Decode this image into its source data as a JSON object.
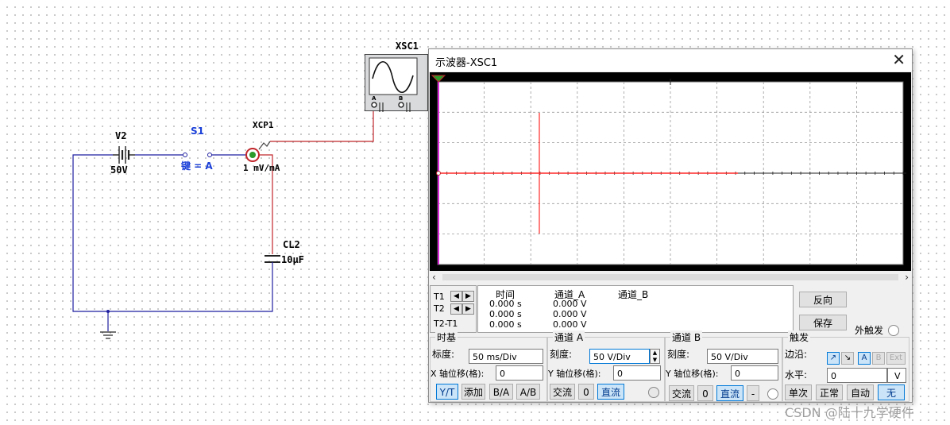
{
  "schematic": {
    "v2_name": "V2",
    "v2_value": "50V",
    "s1_name": "S1",
    "s1_key": "键 = A",
    "xcp1_name": "XCP1",
    "xcp1_ratio": "1  mV/mA",
    "cl2_name": "CL2",
    "cl2_value": "10µF",
    "xsc1_name": "XSC1",
    "xsc1_port_a": "A",
    "xsc1_port_b": "B",
    "wire_color": "#c0262b"
  },
  "dialog": {
    "title": "示波器-XSC1",
    "close": "✕",
    "trace_color": "#ff2828",
    "cursor_color": "#e000e0",
    "cursors": {
      "t1": "T1",
      "t2": "T2",
      "t2t1": "T2-T1"
    },
    "readout": {
      "headers": [
        "时间",
        "通道_A",
        "通道_B"
      ],
      "rows": [
        {
          "time": "0.000 s",
          "a": "0.000 V",
          "b": ""
        },
        {
          "time": "0.000 s",
          "a": "0.000 V",
          "b": ""
        },
        {
          "time": "0.000 s",
          "a": "0.000 V",
          "b": ""
        }
      ]
    },
    "buttons": {
      "reverse": "反向",
      "save": "保存",
      "ext_trigger": "外触发"
    },
    "timebase": {
      "title": "时基",
      "scale_label": "标度:",
      "scale_value": "50 ms/Div",
      "xpos_label": "X 轴位移(格):",
      "xpos_value": "0",
      "modes": [
        "Y/T",
        "添加",
        "B/A",
        "A/B"
      ]
    },
    "channel_a": {
      "title": "通道 A",
      "scale_label": "刻度:",
      "scale_value": "50  V/Div",
      "ypos_label": "Y 轴位移(格):",
      "ypos_value": "0",
      "coupling": [
        "交流",
        "0",
        "直流"
      ]
    },
    "channel_b": {
      "title": "通道 B",
      "scale_label": "刻度:",
      "scale_value": "50  V/Div",
      "ypos_label": "Y 轴位移(格):",
      "ypos_value": "0",
      "coupling": [
        "交流",
        "0",
        "直流",
        "-"
      ]
    },
    "trigger": {
      "title": "触发",
      "edge_label": "边沿:",
      "edge_buttons": [
        "A",
        "B",
        "Ext"
      ],
      "level_label": "水平:",
      "level_value": "0",
      "level_unit": "V",
      "modes": [
        "单次",
        "正常",
        "自动",
        "无"
      ]
    }
  },
  "watermark": "CSDN @陆十九学硬件"
}
